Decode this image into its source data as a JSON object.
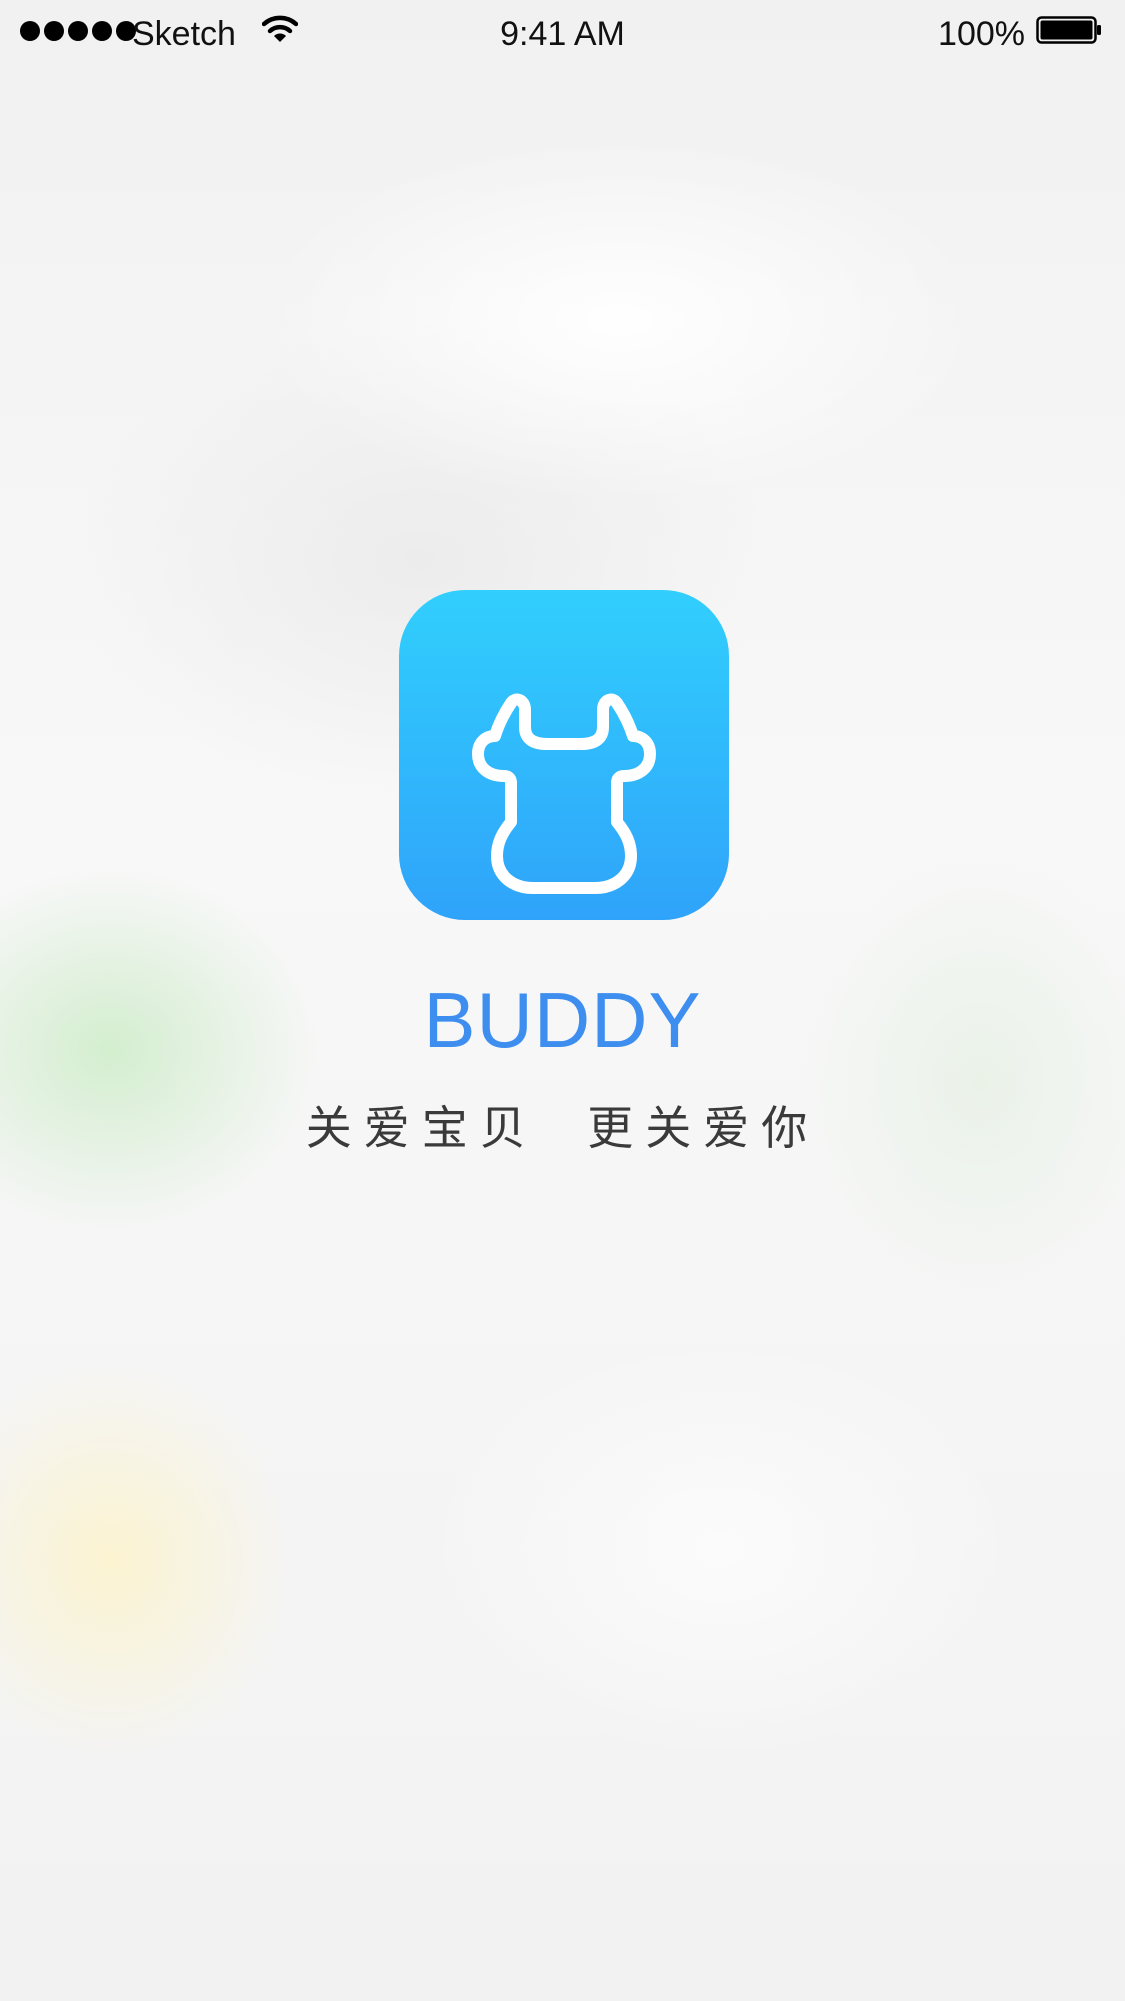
{
  "status_bar": {
    "carrier": "Sketch",
    "time": "9:41 AM",
    "battery": "100%",
    "signal_bars": 5,
    "icons": [
      "signal-dots-icon",
      "wifi-icon",
      "battery-icon"
    ]
  },
  "splash": {
    "app_name": "BUDDY",
    "slogan": "关爱宝贝  更关爱你",
    "logo_icon": "bull-head-icon"
  },
  "colors": {
    "icon_gradient_top": "#31cffd",
    "icon_gradient_bottom": "#2fa3fa",
    "app_name": "#3e8ef0",
    "slogan": "#3a3a3a"
  }
}
